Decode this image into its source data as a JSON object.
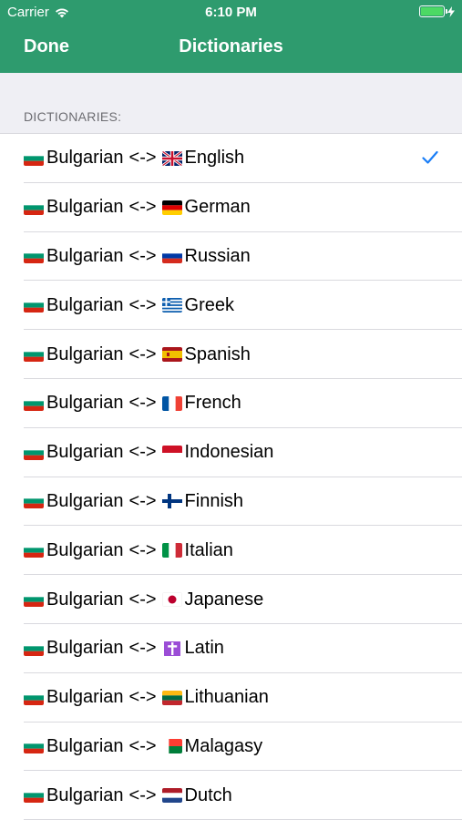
{
  "status_bar": {
    "carrier": "Carrier",
    "time": "6:10 PM",
    "battery_level": 1.0,
    "icons": [
      "wifi-icon",
      "battery-icon",
      "charging-bolt-icon"
    ]
  },
  "nav": {
    "done_label": "Done",
    "title": "Dictionaries"
  },
  "section": {
    "header": "DICTIONARIES:"
  },
  "colors": {
    "header_bg": "#2e9b6e",
    "accent": "#1a7ef7",
    "separator": "#d9d9de"
  },
  "dictionaries": [
    {
      "source": "Bulgarian",
      "arrow": "<->",
      "target": "English",
      "source_flag": "flag-bulgaria-icon",
      "target_flag": "flag-uk-icon",
      "selected": true
    },
    {
      "source": "Bulgarian",
      "arrow": "<->",
      "target": "German",
      "source_flag": "flag-bulgaria-icon",
      "target_flag": "flag-germany-icon",
      "selected": false
    },
    {
      "source": "Bulgarian",
      "arrow": "<->",
      "target": "Russian",
      "source_flag": "flag-bulgaria-icon",
      "target_flag": "flag-russia-icon",
      "selected": false
    },
    {
      "source": "Bulgarian",
      "arrow": "<->",
      "target": "Greek",
      "source_flag": "flag-bulgaria-icon",
      "target_flag": "flag-greece-icon",
      "selected": false
    },
    {
      "source": "Bulgarian",
      "arrow": "<->",
      "target": "Spanish",
      "source_flag": "flag-bulgaria-icon",
      "target_flag": "flag-spain-icon",
      "selected": false
    },
    {
      "source": "Bulgarian",
      "arrow": "<->",
      "target": "French",
      "source_flag": "flag-bulgaria-icon",
      "target_flag": "flag-france-icon",
      "selected": false
    },
    {
      "source": "Bulgarian",
      "arrow": "<->",
      "target": "Indonesian",
      "source_flag": "flag-bulgaria-icon",
      "target_flag": "flag-indonesia-icon",
      "selected": false
    },
    {
      "source": "Bulgarian",
      "arrow": "<->",
      "target": "Finnish",
      "source_flag": "flag-bulgaria-icon",
      "target_flag": "flag-finland-icon",
      "selected": false
    },
    {
      "source": "Bulgarian",
      "arrow": "<->",
      "target": "Italian",
      "source_flag": "flag-bulgaria-icon",
      "target_flag": "flag-italy-icon",
      "selected": false
    },
    {
      "source": "Bulgarian",
      "arrow": "<->",
      "target": "Japanese",
      "source_flag": "flag-bulgaria-icon",
      "target_flag": "flag-japan-icon",
      "selected": false
    },
    {
      "source": "Bulgarian",
      "arrow": "<->",
      "target": "Latin",
      "source_flag": "flag-bulgaria-icon",
      "target_flag": "latin-cross-icon",
      "selected": false
    },
    {
      "source": "Bulgarian",
      "arrow": "<->",
      "target": "Lithuanian",
      "source_flag": "flag-bulgaria-icon",
      "target_flag": "flag-lithuania-icon",
      "selected": false
    },
    {
      "source": "Bulgarian",
      "arrow": "<->",
      "target": "Malagasy",
      "source_flag": "flag-bulgaria-icon",
      "target_flag": "flag-madagascar-icon",
      "selected": false
    },
    {
      "source": "Bulgarian",
      "arrow": "<->",
      "target": "Dutch",
      "source_flag": "flag-bulgaria-icon",
      "target_flag": "flag-netherlands-icon",
      "selected": false
    }
  ]
}
